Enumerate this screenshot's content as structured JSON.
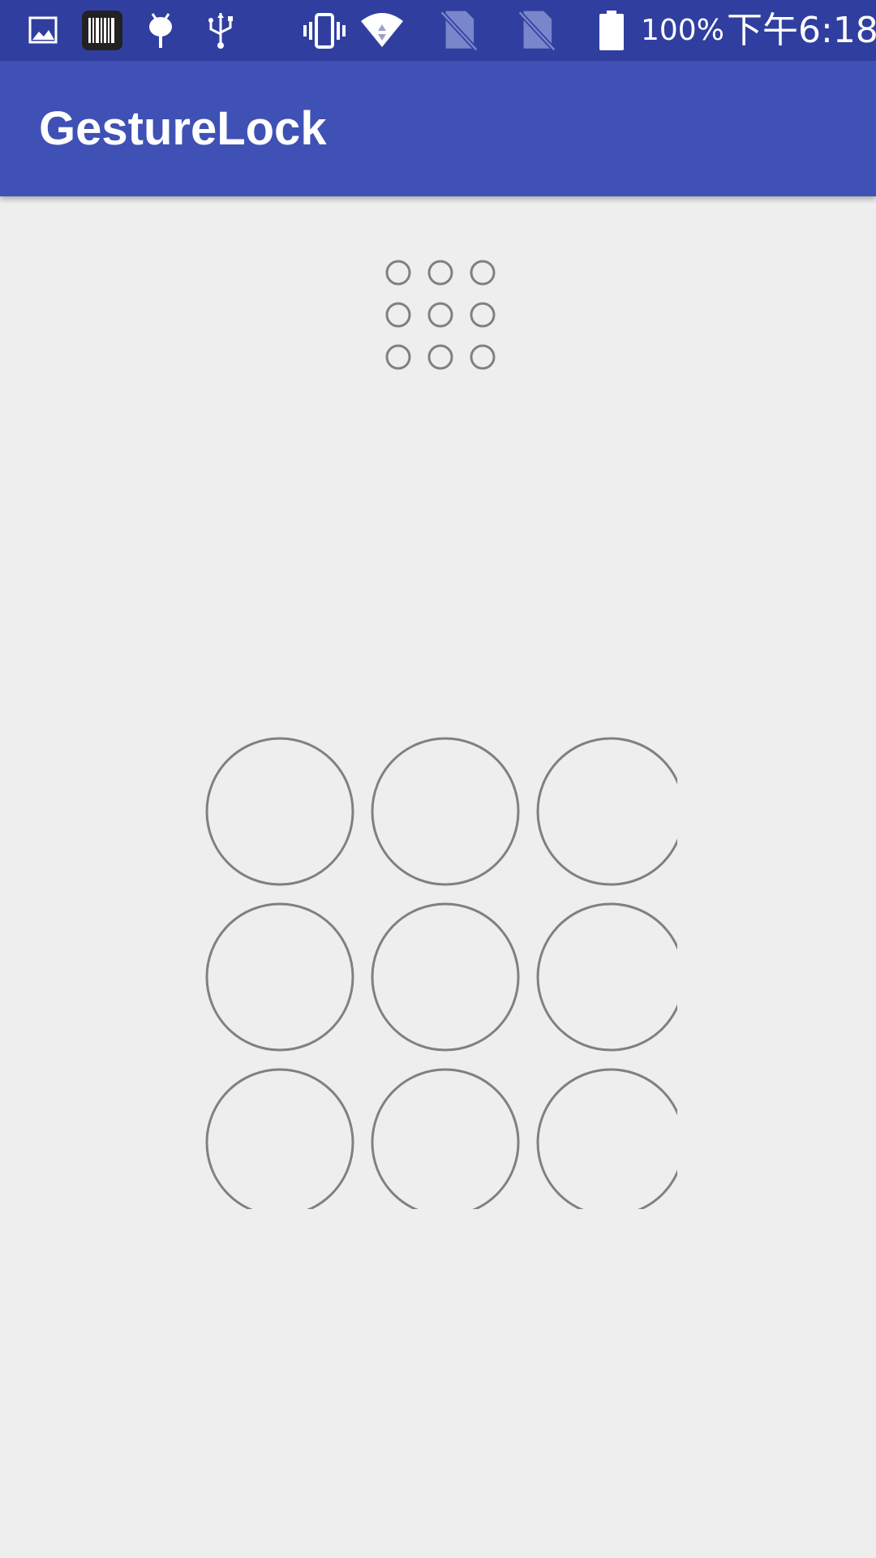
{
  "status_bar": {
    "battery_percent": "100%",
    "time": "下午6:18",
    "icons": [
      "gallery-icon",
      "barcode-icon",
      "android-debug-icon",
      "usb-icon",
      "vibrate-icon",
      "wifi-icon",
      "no-sim-icon",
      "no-sim-icon",
      "battery-icon"
    ]
  },
  "app_bar": {
    "title": "GestureLock",
    "color": "#3f51b5"
  },
  "gesture_preview": {
    "rows": 3,
    "cols": 3,
    "selected": []
  },
  "gesture_lock": {
    "rows": 3,
    "cols": 3,
    "selected": [],
    "circle_color": "#808080"
  }
}
